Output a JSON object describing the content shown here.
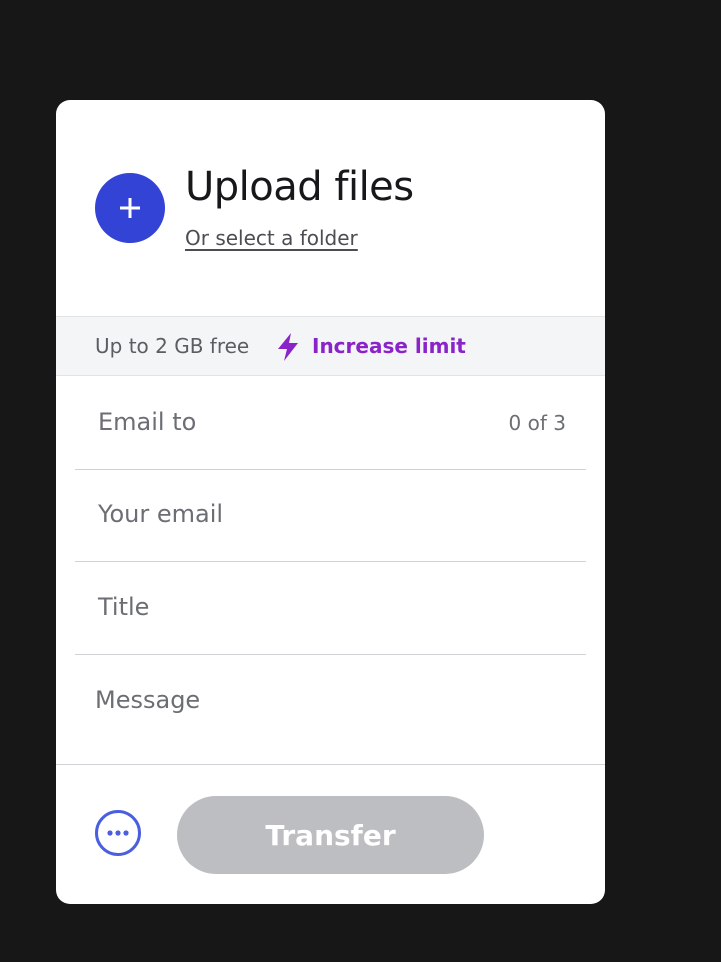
{
  "upload": {
    "title": "Upload files",
    "folder_link": "Or select a folder"
  },
  "limit": {
    "text": "Up to 2 GB free",
    "link": "Increase limit",
    "icon": "lightning-bolt-icon",
    "link_color": "#8a24c9"
  },
  "form": {
    "email_to": {
      "placeholder": "Email to",
      "counter": "0 of 3"
    },
    "your_email": {
      "placeholder": "Your email"
    },
    "title": {
      "placeholder": "Title"
    },
    "message": {
      "placeholder": "Message"
    }
  },
  "actions": {
    "more_icon": "more-options-icon",
    "transfer_label": "Transfer"
  },
  "colors": {
    "accent": "#3343d6",
    "background": "#171717",
    "disabled_button": "#bdbec2"
  }
}
